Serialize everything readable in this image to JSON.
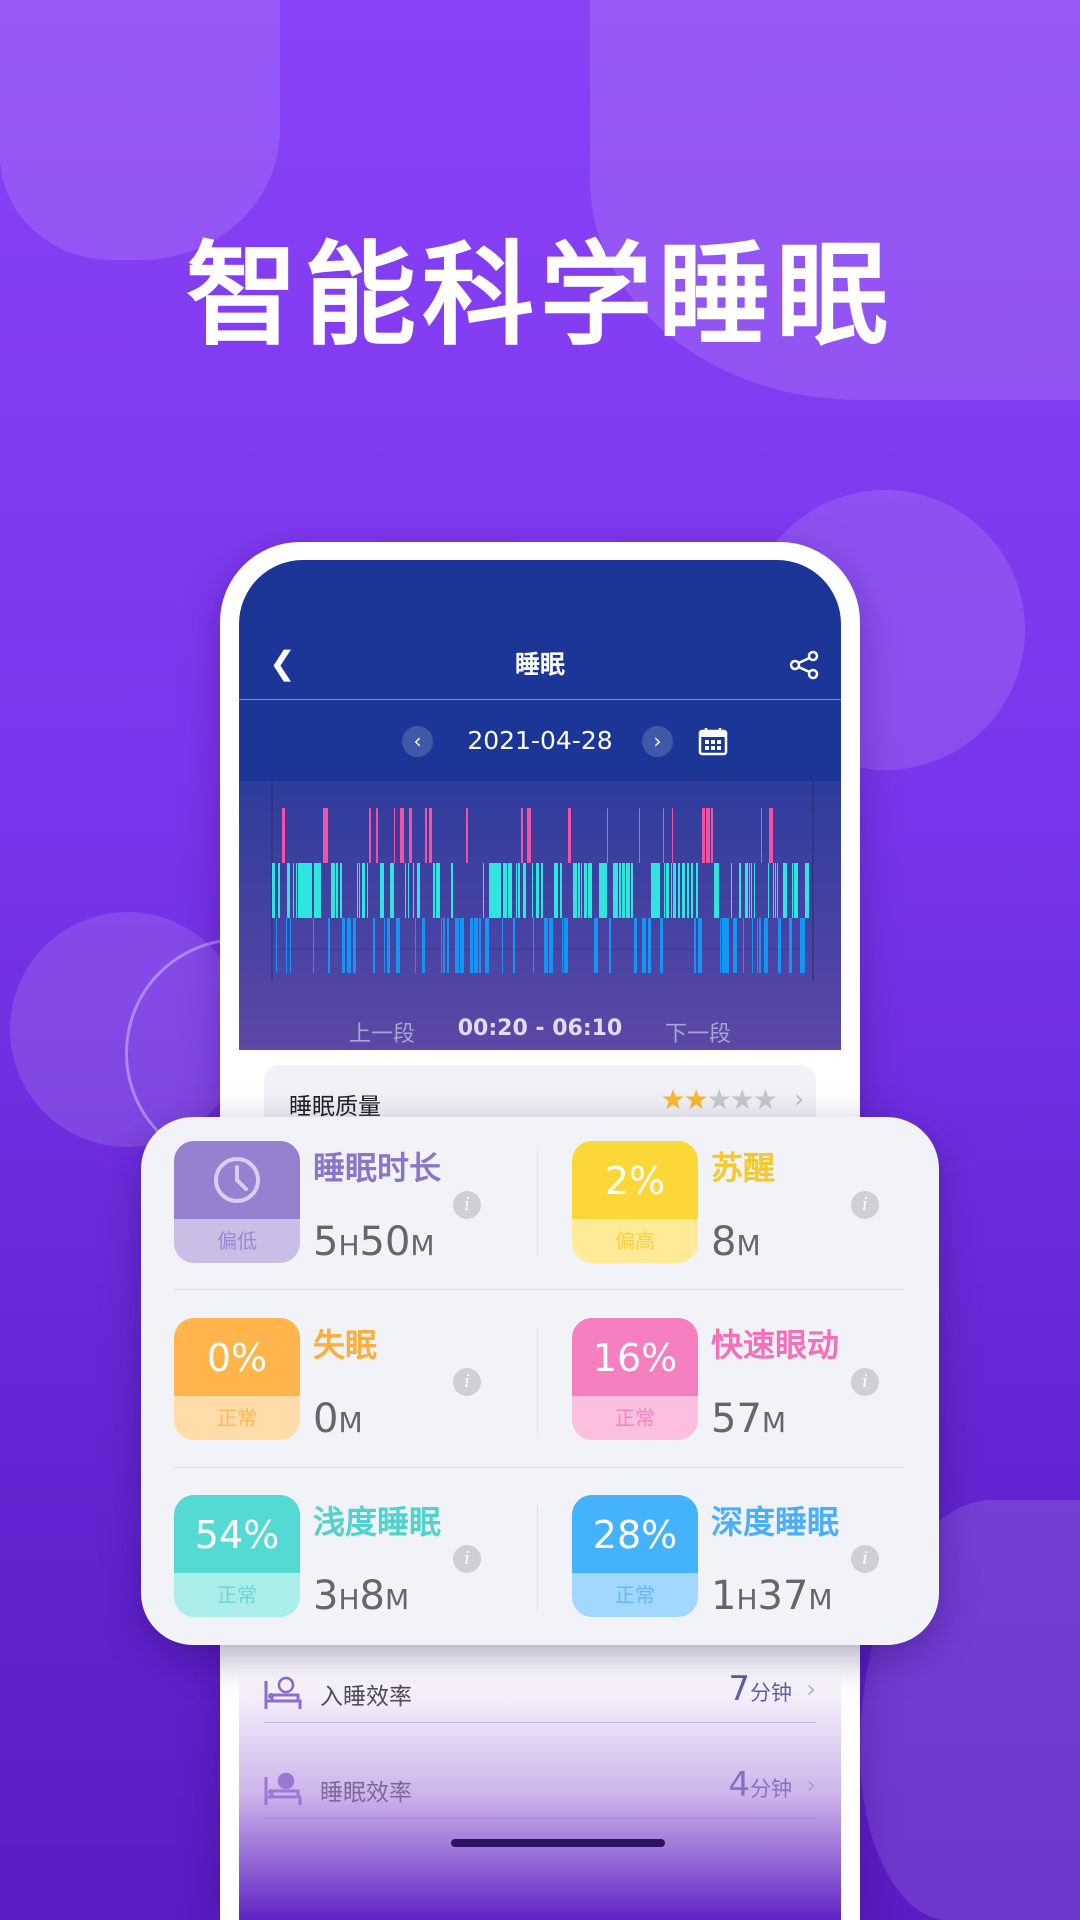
{
  "headline": "智能科学睡眠",
  "app": {
    "nav_title": "睡眠",
    "date": "2021-04-28",
    "segment": {
      "prev": "上一段",
      "range": "00:20 - 06:10",
      "next": "下一段"
    },
    "quality": {
      "label": "睡眠质量",
      "stars": 2,
      "max_stars": 5
    }
  },
  "chart_data": {
    "type": "timeline",
    "x_range": [
      "00:20",
      "06:10"
    ],
    "stages": [
      {
        "key": "rem",
        "color": "#f551a2"
      },
      {
        "key": "light",
        "color": "#2ee6de"
      },
      {
        "key": "deep",
        "color": "#1496f5"
      }
    ]
  },
  "metrics": [
    {
      "name": "睡眠时长",
      "tile": "clock-icon",
      "status": "偏低",
      "value": "5",
      "u1": "H",
      "value2": "50",
      "u2": "M",
      "color": "#9680d0",
      "light": "#c9bfe6",
      "text": "#8a76c8"
    },
    {
      "name": "苏醒",
      "tile": "2%",
      "status": "偏高",
      "value": "8",
      "u1": "M",
      "value2": "",
      "u2": "",
      "color": "#fbd737",
      "light": "#feea97",
      "text": "#f4c928"
    },
    {
      "name": "失眠",
      "tile": "0%",
      "status": "正常",
      "value": "0",
      "u1": "M",
      "value2": "",
      "u2": "",
      "color": "#ffb54b",
      "light": "#ffdca8",
      "text": "#ffae3c"
    },
    {
      "name": "快速眼动",
      "tile": "16%",
      "status": "正常",
      "value": "57",
      "u1": "M",
      "value2": "",
      "u2": "",
      "color": "#f57fbf",
      "light": "#fbbfdf",
      "text": "#f570b8"
    },
    {
      "name": "浅度睡眠",
      "tile": "54%",
      "status": "正常",
      "value": "3",
      "u1": "H",
      "value2": "8",
      "u2": "M",
      "color": "#55d9d3",
      "light": "#abede9",
      "text": "#4fd3cc"
    },
    {
      "name": "深度睡眠",
      "tile": "28%",
      "status": "正常",
      "value": "1",
      "u1": "H",
      "value2": "37",
      "u2": "M",
      "color": "#44b2fd",
      "light": "#a3d8fe",
      "text": "#4aaefc"
    }
  ],
  "list": [
    {
      "label": "入睡效率",
      "value": "7",
      "unit": "分钟",
      "icon": "bed-clock-icon"
    },
    {
      "label": "睡眠效率",
      "value": "4",
      "unit": "分钟",
      "icon": "bed-pie-icon"
    }
  ]
}
